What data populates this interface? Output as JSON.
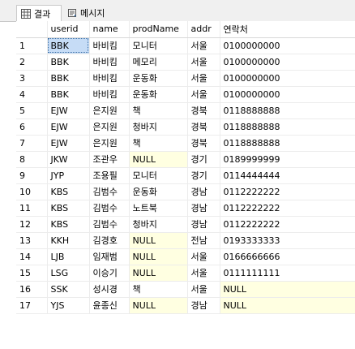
{
  "tabs": [
    {
      "label": "결과",
      "icon": "grid-icon",
      "active": true
    },
    {
      "label": "메시지",
      "icon": "message-icon",
      "active": false
    }
  ],
  "grid": {
    "columns": [
      "",
      "userid",
      "name",
      "prodName",
      "addr",
      "연락처"
    ],
    "null_background": "#ffffe1",
    "selected_background": "#c6dcf6",
    "rows": [
      [
        "1",
        "BBK",
        "바비킴",
        "모니터",
        "서울",
        "0100000000"
      ],
      [
        "2",
        "BBK",
        "바비킴",
        "메모리",
        "서울",
        "0100000000"
      ],
      [
        "3",
        "BBK",
        "바비킴",
        "운동화",
        "서울",
        "0100000000"
      ],
      [
        "4",
        "BBK",
        "바비킴",
        "운동화",
        "서울",
        "0100000000"
      ],
      [
        "5",
        "EJW",
        "은지원",
        "책",
        "경북",
        "0118888888"
      ],
      [
        "6",
        "EJW",
        "은지원",
        "청바지",
        "경북",
        "0118888888"
      ],
      [
        "7",
        "EJW",
        "은지원",
        "책",
        "경북",
        "0118888888"
      ],
      [
        "8",
        "JKW",
        "조관우",
        "NULL",
        "경기",
        "0189999999"
      ],
      [
        "9",
        "JYP",
        "조용필",
        "모니터",
        "경기",
        "0114444444"
      ],
      [
        "10",
        "KBS",
        "김범수",
        "운동화",
        "경남",
        "0112222222"
      ],
      [
        "11",
        "KBS",
        "김범수",
        "노트북",
        "경남",
        "0112222222"
      ],
      [
        "12",
        "KBS",
        "김범수",
        "청바지",
        "경남",
        "0112222222"
      ],
      [
        "13",
        "KKH",
        "김경호",
        "NULL",
        "전남",
        "0193333333"
      ],
      [
        "14",
        "LJB",
        "임재범",
        "NULL",
        "서울",
        "0166666666"
      ],
      [
        "15",
        "LSG",
        "이승기",
        "NULL",
        "서울",
        "0111111111"
      ],
      [
        "16",
        "SSK",
        "성시경",
        "책",
        "서울",
        "NULL"
      ],
      [
        "17",
        "YJS",
        "윤종신",
        "NULL",
        "경남",
        "NULL"
      ]
    ]
  }
}
